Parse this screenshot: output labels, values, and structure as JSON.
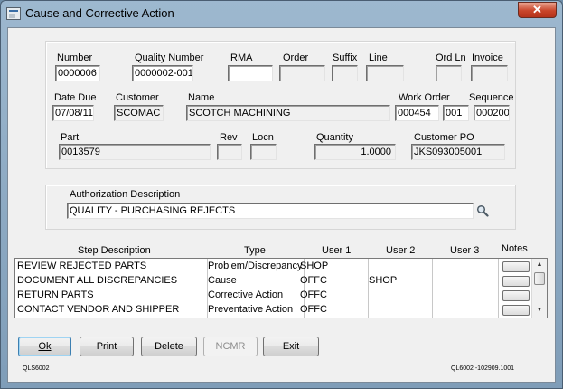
{
  "window": {
    "title": "Cause and Corrective Action",
    "close_glyph": "✕"
  },
  "header": {
    "number_label": "Number",
    "number_value": "0000006",
    "quality_number_label": "Quality Number",
    "quality_number_value": "0000002-001",
    "rma_label": "RMA",
    "rma_value": "",
    "order_label": "Order",
    "order_value": "",
    "suffix_label": "Suffix",
    "suffix_value": "",
    "line_label": "Line",
    "line_value": "",
    "ord_ln_label": "Ord Ln",
    "ord_ln_value": "",
    "invoice_label": "Invoice",
    "invoice_value": "",
    "date_due_label": "Date Due",
    "date_due_value": "07/08/11",
    "customer_label": "Customer",
    "customer_value": "SCOMAC",
    "name_label": "Name",
    "name_value": "SCOTCH MACHINING",
    "work_order_label": "Work Order",
    "work_order_value": "000454",
    "work_order_suffix_value": "001",
    "sequence_label": "Sequence",
    "sequence_value": "000200",
    "part_label": "Part",
    "part_value": "0013579",
    "rev_label": "Rev",
    "rev_value": "",
    "locn_label": "Locn",
    "locn_value": "",
    "quantity_label": "Quantity",
    "quantity_value": "1.0000",
    "customer_po_label": "Customer PO",
    "customer_po_value": "JKS093005001"
  },
  "authorization": {
    "label": "Authorization Description",
    "value": "QUALITY - PURCHASING REJECTS",
    "lookup_icon": "magnifier-icon"
  },
  "steps": {
    "columns": [
      "Step Description",
      "Type",
      "User 1",
      "User 2",
      "User 3",
      "Notes"
    ],
    "rows": [
      {
        "description": "REVIEW REJECTED PARTS",
        "type": "Problem/Discrepancy",
        "user1": "SHOP",
        "user2": "",
        "user3": ""
      },
      {
        "description": "DOCUMENT ALL DISCREPANCIES",
        "type": "Cause",
        "user1": "OFFC",
        "user2": "SHOP",
        "user3": ""
      },
      {
        "description": "RETURN PARTS",
        "type": "Corrective Action",
        "user1": "OFFC",
        "user2": "",
        "user3": ""
      },
      {
        "description": "CONTACT VENDOR AND SHIPPER",
        "type": "Preventative Action",
        "user1": "OFFC",
        "user2": "",
        "user3": ""
      }
    ]
  },
  "buttons": {
    "ok": "Ok",
    "print": "Print",
    "delete": "Delete",
    "ncmr": "NCMR",
    "exit": "Exit"
  },
  "footer": {
    "left_code": "QLS6002",
    "right_code": "QL6002 -102909.1001"
  }
}
